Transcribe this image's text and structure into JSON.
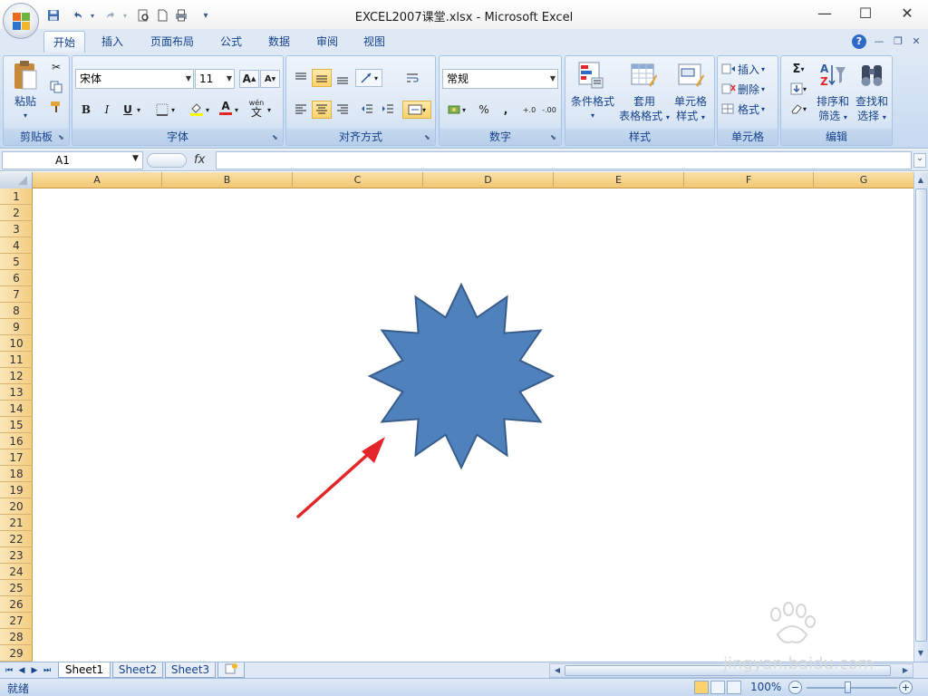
{
  "window": {
    "title": "EXCEL2007课堂.xlsx - Microsoft Excel",
    "minimize": "—",
    "restore": "☐",
    "close": "✕"
  },
  "quick_access": {
    "save_icon": "floppy-icon",
    "undo_icon": "undo-icon",
    "redo_icon": "redo-icon",
    "customize": "▾"
  },
  "tabs": [
    {
      "label": "开始",
      "active": true
    },
    {
      "label": "插入"
    },
    {
      "label": "页面布局"
    },
    {
      "label": "公式"
    },
    {
      "label": "数据"
    },
    {
      "label": "审阅"
    },
    {
      "label": "视图"
    }
  ],
  "ribbon": {
    "clipboard": {
      "label": "剪贴板",
      "paste": "粘贴"
    },
    "font": {
      "label": "字体",
      "name": "宋体",
      "size": "11",
      "bold": "B",
      "italic": "I",
      "underline": "U",
      "grow": "A",
      "shrink": "A",
      "color": "A",
      "phonetic": "wén"
    },
    "align": {
      "label": "对齐方式"
    },
    "number": {
      "label": "数字",
      "format": "常规",
      "percent": "%",
      "comma": ",",
      "inc_dec": "+.0",
      "dec_dec": "-.00"
    },
    "styles": {
      "label": "样式",
      "conditional": "条件格式",
      "table_1": "套用",
      "table_2": "表格格式",
      "cell_1": "单元格",
      "cell_2": "样式"
    },
    "cells": {
      "label": "单元格",
      "insert": "插入",
      "delete": "删除",
      "format": "格式"
    },
    "editing": {
      "label": "编辑",
      "sigma": "Σ",
      "sort_1": "排序和",
      "sort_2": "筛选",
      "find_1": "查找和",
      "find_2": "选择"
    }
  },
  "formula_bar": {
    "name_box": "A1",
    "fx": "fx",
    "content": ""
  },
  "columns": [
    "A",
    "B",
    "C",
    "D",
    "E",
    "F",
    "G"
  ],
  "rows": [
    "1",
    "2",
    "3",
    "4",
    "5",
    "6",
    "7",
    "8",
    "9",
    "10",
    "11",
    "12",
    "13",
    "14",
    "15",
    "16",
    "17",
    "18",
    "19",
    "20",
    "21",
    "22",
    "23",
    "24",
    "25",
    "26",
    "27",
    "28",
    "29"
  ],
  "sheet_tabs": [
    {
      "label": "Sheet1",
      "active": true
    },
    {
      "label": "Sheet2"
    },
    {
      "label": "Sheet3"
    }
  ],
  "status": {
    "text": "就绪",
    "zoom": "100%",
    "zoom_out": "−",
    "zoom_in": "+"
  },
  "shape": {
    "type": "12-point-star",
    "fill": "#4f81bd",
    "stroke": "#385d8a"
  },
  "annotation": {
    "type": "arrow",
    "color": "#e3262a"
  },
  "watermark": {
    "text": "jingyan.baidu.com"
  }
}
